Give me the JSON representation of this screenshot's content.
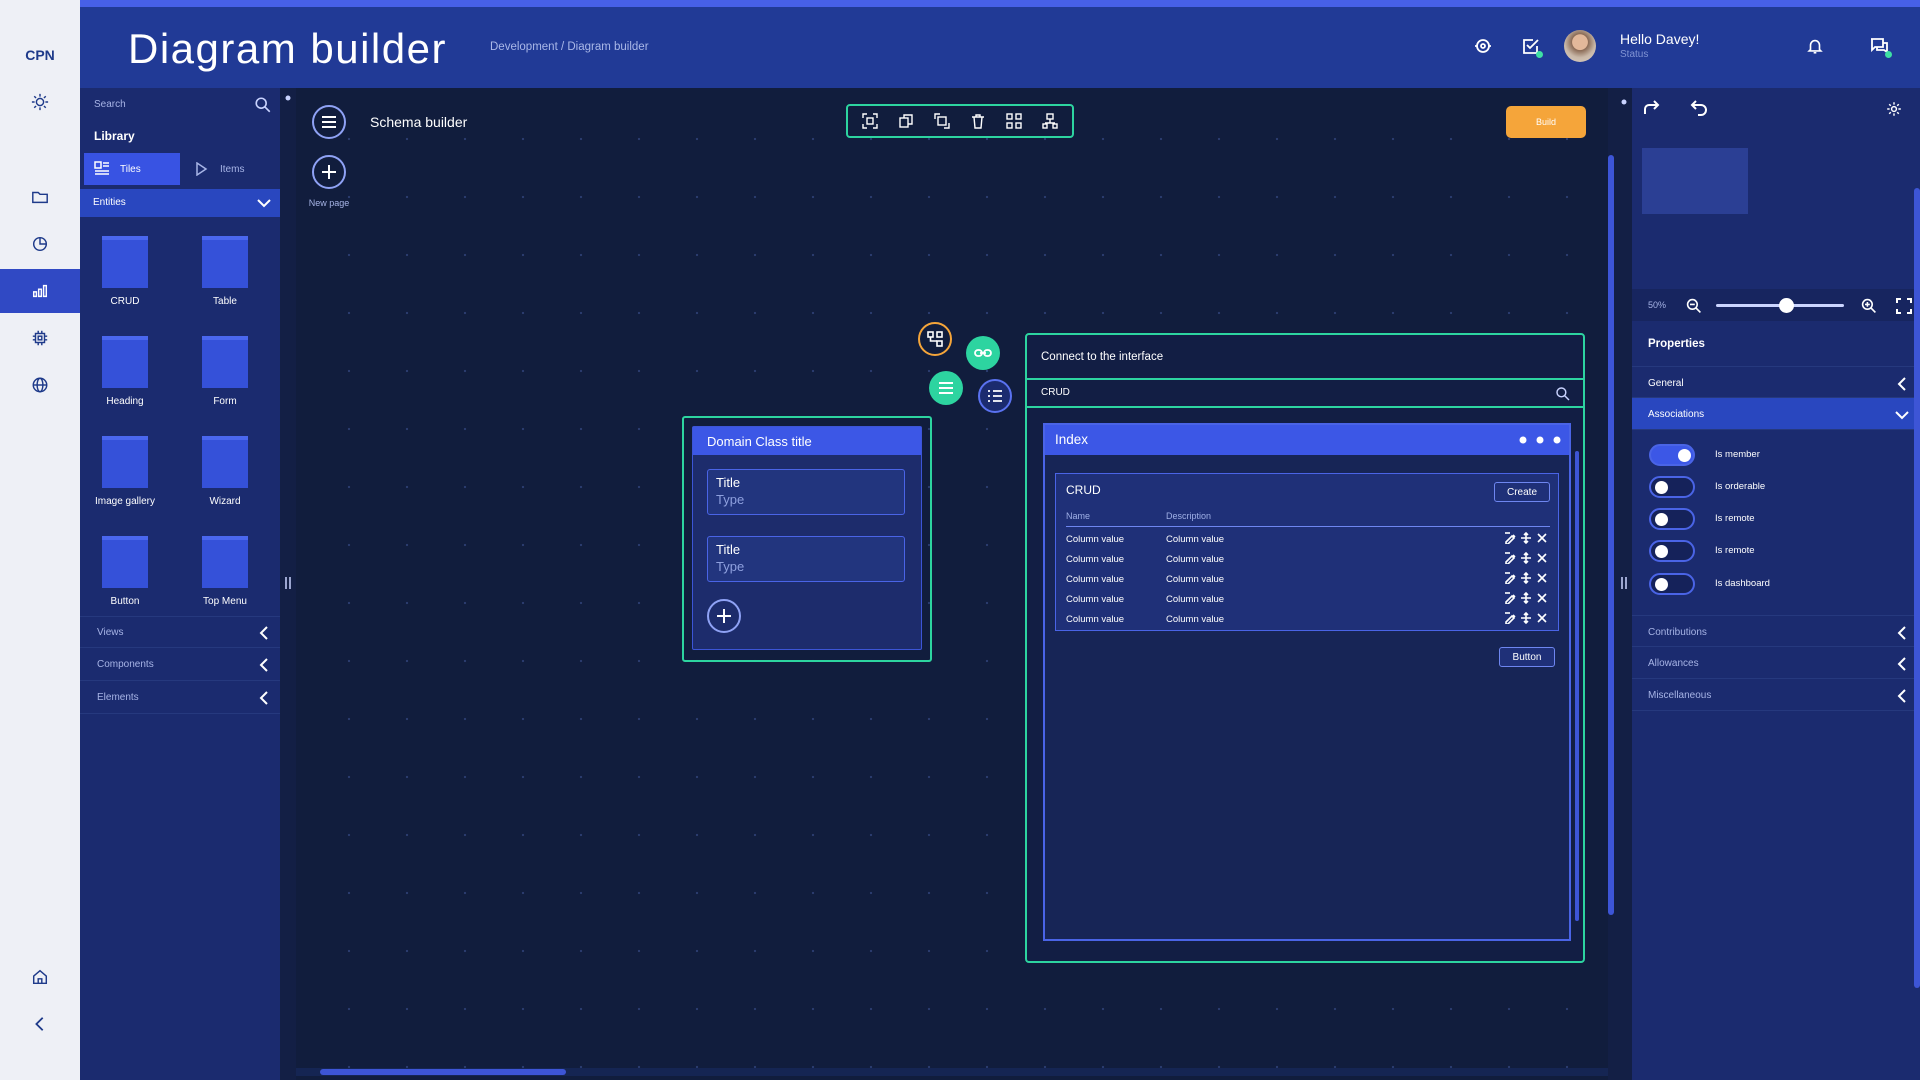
{
  "app": {
    "logo": "CPN",
    "title": "Diagram builder"
  },
  "breadcrumb": "Development  / Diagram builder",
  "user": {
    "greeting": "Hello Davey!",
    "status": "Status"
  },
  "library": {
    "search_placeholder": "Search",
    "title": "Library",
    "tabs": [
      {
        "label": "Tiles",
        "icon": "tiles-icon"
      },
      {
        "label": "Items",
        "icon": "play-icon"
      }
    ],
    "section": "Entities",
    "tiles": [
      "CRUD",
      "Table",
      "Heading",
      "Form",
      "Image gallery",
      "Wizard",
      "Button",
      "Top Menu"
    ],
    "accordions": [
      "Views",
      "Components",
      "Elements"
    ]
  },
  "canvas": {
    "page_title": "Schema builder",
    "new_page_label": "New page",
    "build_label": "Build",
    "toolbar_icons": [
      "group-icon",
      "copy-icon",
      "ungroup-icon",
      "delete-icon",
      "connect-icon",
      "hierarchy-icon"
    ]
  },
  "domain_card": {
    "title": "Domain Class title",
    "fields": [
      {
        "title": "Title",
        "type": "Type"
      },
      {
        "title": "Title",
        "type": "Type"
      }
    ]
  },
  "connect_panel": {
    "title": "Connect to the interface",
    "search_value": "CRUD",
    "index": {
      "title": "Index",
      "crud": {
        "title": "CRUD",
        "create_label": "Create",
        "columns": [
          "Name",
          "Description"
        ],
        "rows": [
          [
            "Column value",
            "Column value"
          ],
          [
            "Column value",
            "Column value"
          ],
          [
            "Column value",
            "Column value"
          ],
          [
            "Column value",
            "Column value"
          ],
          [
            "Column value",
            "Column value"
          ]
        ]
      },
      "button_label": "Button"
    }
  },
  "properties": {
    "zoom": "50%",
    "zoom_level": 0.55,
    "title": "Properties",
    "sections": [
      "General",
      "Associations"
    ],
    "toggles": [
      {
        "label": "Is member",
        "on": true
      },
      {
        "label": "Is orderable",
        "on": false
      },
      {
        "label": "Is remote",
        "on": false
      },
      {
        "label": "Is remote",
        "on": false
      },
      {
        "label": "Is dashboard",
        "on": false
      }
    ],
    "more_sections": [
      "Contributions",
      "Allowances",
      "Miscellaneous"
    ]
  },
  "colors": {
    "accent": "#3c57e6",
    "header": "#213a96",
    "success": "#2dd4a0",
    "warning": "#f5a53a"
  }
}
